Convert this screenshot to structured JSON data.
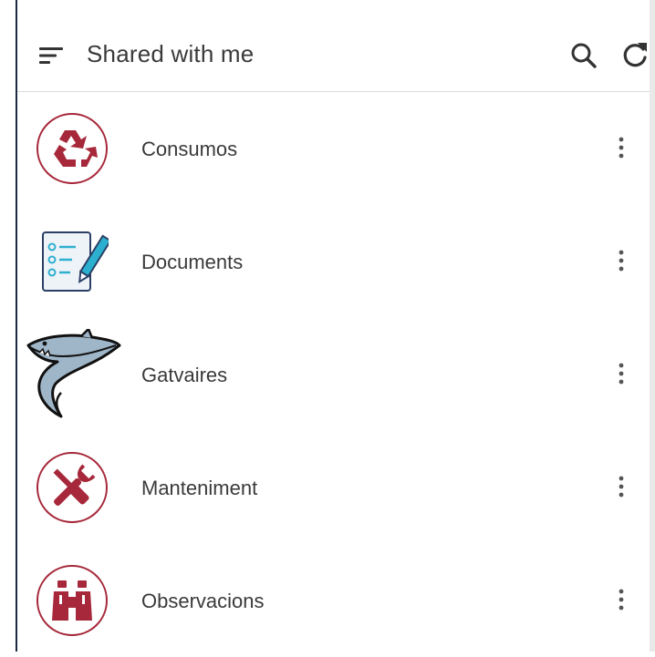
{
  "header": {
    "title": "Shared with me",
    "menu_icon": "sort-lines-icon",
    "search_icon": "search-icon",
    "refresh_icon": "refresh-icon"
  },
  "items": [
    {
      "label": "Consumos",
      "icon": "recycle-icon"
    },
    {
      "label": "Documents",
      "icon": "checklist-pencil-icon"
    },
    {
      "label": "Gatvaires",
      "icon": "shark-icon"
    },
    {
      "label": "Manteniment",
      "icon": "wrench-screwdriver-icon"
    },
    {
      "label": "Observacions",
      "icon": "binoculars-icon"
    }
  ],
  "colors": {
    "accent": "#a6283a",
    "text": "#3a3a3a",
    "icon_gray": "#333333"
  }
}
